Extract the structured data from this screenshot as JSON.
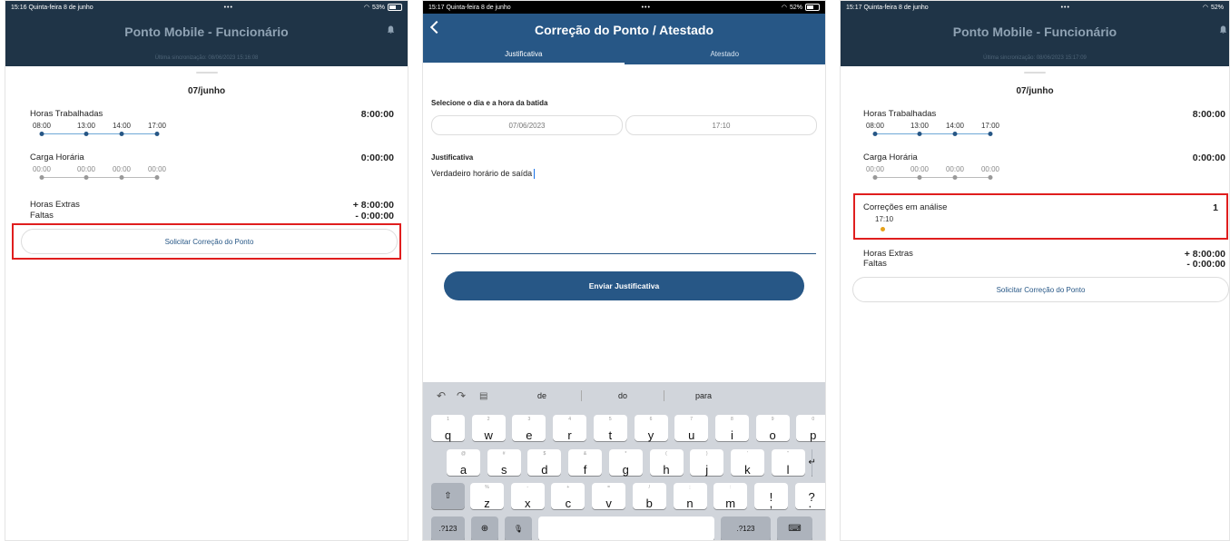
{
  "screen1": {
    "status": {
      "time": "15:16",
      "date": "Quinta-feira 8 de junho",
      "battery": "53%"
    },
    "title": "Ponto Mobile - Funcionário",
    "subtitle": "Última sincronização: 08/06/2023 15:16:08",
    "day": "07/junho",
    "worked": {
      "label": "Horas Trabalhadas",
      "value": "8:00:00",
      "times": [
        "08:00",
        "13:00",
        "14:00",
        "17:00"
      ]
    },
    "load": {
      "label": "Carga Horária",
      "value": "0:00:00",
      "times": [
        "00:00",
        "00:00",
        "00:00",
        "00:00"
      ]
    },
    "extra": {
      "label": "Horas Extras",
      "value": "+ 8:00:00"
    },
    "absence": {
      "label": "Faltas",
      "value": "- 0:00:00"
    },
    "button": "Solicitar Correção do Ponto"
  },
  "screen2": {
    "status": {
      "time": "15:17",
      "date": "Quinta-feira 8 de junho",
      "battery": "52%"
    },
    "title": "Correção do Ponto / Atestado",
    "tabs": [
      "Justificativa",
      "Atestado"
    ],
    "select_label": "Selecione o dia e a hora da batida",
    "date_value": "07/06/2023",
    "time_value": "17:10",
    "just_label": "Justificativa",
    "just_text": "Verdadeiro horário de saída",
    "send": "Enviar Justificativa",
    "keyboard": {
      "suggestions": [
        "de",
        "do",
        "para"
      ],
      "row1": [
        [
          "1",
          "q"
        ],
        [
          "2",
          "w"
        ],
        [
          "3",
          "e"
        ],
        [
          "4",
          "r"
        ],
        [
          "5",
          "t"
        ],
        [
          "6",
          "y"
        ],
        [
          "7",
          "u"
        ],
        [
          "8",
          "i"
        ],
        [
          "9",
          "o"
        ],
        [
          "0",
          "p"
        ]
      ],
      "row2": [
        [
          "@",
          "a"
        ],
        [
          "#",
          "s"
        ],
        [
          "$",
          "d"
        ],
        [
          "&",
          "f"
        ],
        [
          "*",
          "g"
        ],
        [
          "(",
          "h"
        ],
        [
          ")",
          "j"
        ],
        [
          "'",
          "k"
        ],
        [
          "\"",
          "l"
        ]
      ],
      "row3": [
        [
          "%",
          "z"
        ],
        [
          "-",
          "x"
        ],
        [
          "+",
          "c"
        ],
        [
          "=",
          "v"
        ],
        [
          "/",
          "b"
        ],
        [
          ";",
          "n"
        ],
        [
          ":",
          "m"
        ],
        [
          "",
          "!\n,"
        ],
        [
          "",
          "?\n."
        ]
      ],
      "num_label": ".?123"
    }
  },
  "screen3": {
    "status": {
      "time": "15:17",
      "date": "Quinta-feira 8 de junho",
      "battery": "52%"
    },
    "title": "Ponto Mobile - Funcionário",
    "subtitle": "Última sincronização: 08/06/2023 15:17:09",
    "day": "07/junho",
    "worked": {
      "label": "Horas Trabalhadas",
      "value": "8:00:00",
      "times": [
        "08:00",
        "13:00",
        "14:00",
        "17:00"
      ]
    },
    "load": {
      "label": "Carga Horária",
      "value": "0:00:00",
      "times": [
        "00:00",
        "00:00",
        "00:00",
        "00:00"
      ]
    },
    "pending": {
      "label": "Correções em análise",
      "value": "1",
      "time": "17:10"
    },
    "extra": {
      "label": "Horas Extras",
      "value": "+ 8:00:00"
    },
    "absence": {
      "label": "Faltas",
      "value": "- 0:00:00"
    },
    "button": "Solicitar Correção do Ponto"
  },
  "colors": {
    "header_dark": "#1f3447",
    "header_blue": "#275786",
    "highlight": "#e01e1e",
    "pending_dot": "#e6a21a"
  }
}
